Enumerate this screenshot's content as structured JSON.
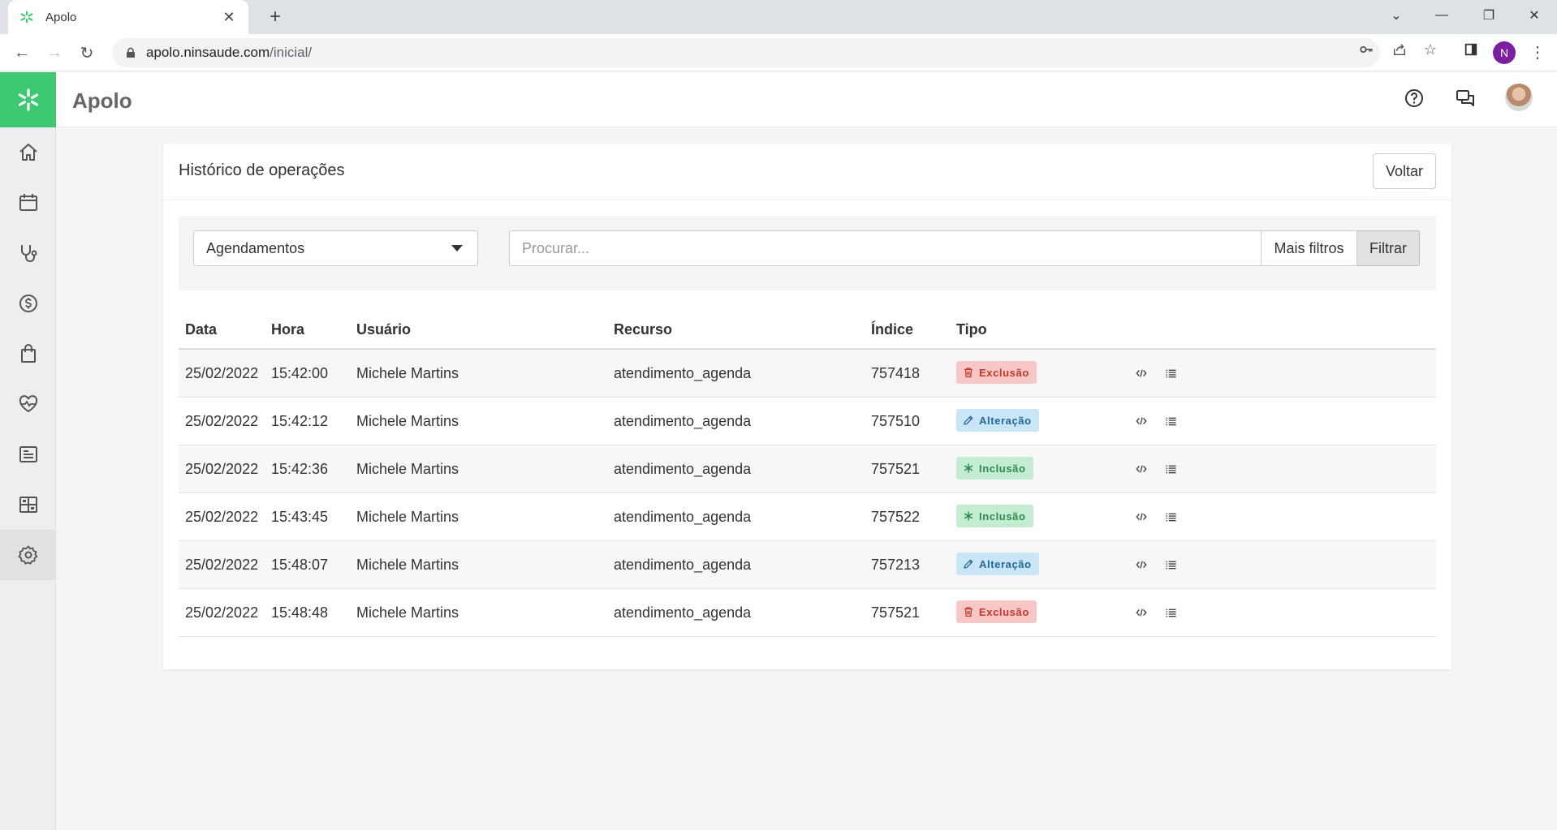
{
  "browser": {
    "tab_title": "Apolo",
    "url_host": "apolo.ninsaude.com",
    "url_path": "/inicial/",
    "profile_initial": "N"
  },
  "app": {
    "title": "Apolo",
    "accent_color": "#3fc872"
  },
  "sidebar": {
    "items": [
      {
        "name": "home-icon"
      },
      {
        "name": "calendar-icon"
      },
      {
        "name": "stethoscope-icon"
      },
      {
        "name": "dollar-icon"
      },
      {
        "name": "shopping-bag-icon"
      },
      {
        "name": "heart-pulse-icon"
      },
      {
        "name": "report-icon"
      },
      {
        "name": "dashboard-icon"
      },
      {
        "name": "gear-icon",
        "active": true
      }
    ]
  },
  "page": {
    "title": "Histórico de operações",
    "back_label": "Voltar"
  },
  "filters": {
    "select_value": "Agendamentos",
    "search_placeholder": "Procurar...",
    "more_filters_label": "Mais filtros",
    "filter_label": "Filtrar"
  },
  "table": {
    "headers": [
      "Data",
      "Hora",
      "Usuário",
      "Recurso",
      "Índice",
      "Tipo"
    ],
    "rows": [
      {
        "data": "25/02/2022",
        "hora": "15:42:00",
        "usuario": "Michele Martins",
        "recurso": "atendimento_agenda",
        "indice": "757418",
        "tipo": "Exclusão",
        "kind": "del"
      },
      {
        "data": "25/02/2022",
        "hora": "15:42:12",
        "usuario": "Michele Martins",
        "recurso": "atendimento_agenda",
        "indice": "757510",
        "tipo": "Alteração",
        "kind": "alt"
      },
      {
        "data": "25/02/2022",
        "hora": "15:42:36",
        "usuario": "Michele Martins",
        "recurso": "atendimento_agenda",
        "indice": "757521",
        "tipo": "Inclusão",
        "kind": "inc"
      },
      {
        "data": "25/02/2022",
        "hora": "15:43:45",
        "usuario": "Michele Martins",
        "recurso": "atendimento_agenda",
        "indice": "757522",
        "tipo": "Inclusão",
        "kind": "inc"
      },
      {
        "data": "25/02/2022",
        "hora": "15:48:07",
        "usuario": "Michele Martins",
        "recurso": "atendimento_agenda",
        "indice": "757213",
        "tipo": "Alteração",
        "kind": "alt"
      },
      {
        "data": "25/02/2022",
        "hora": "15:48:48",
        "usuario": "Michele Martins",
        "recurso": "atendimento_agenda",
        "indice": "757521",
        "tipo": "Exclusão",
        "kind": "del"
      }
    ]
  }
}
